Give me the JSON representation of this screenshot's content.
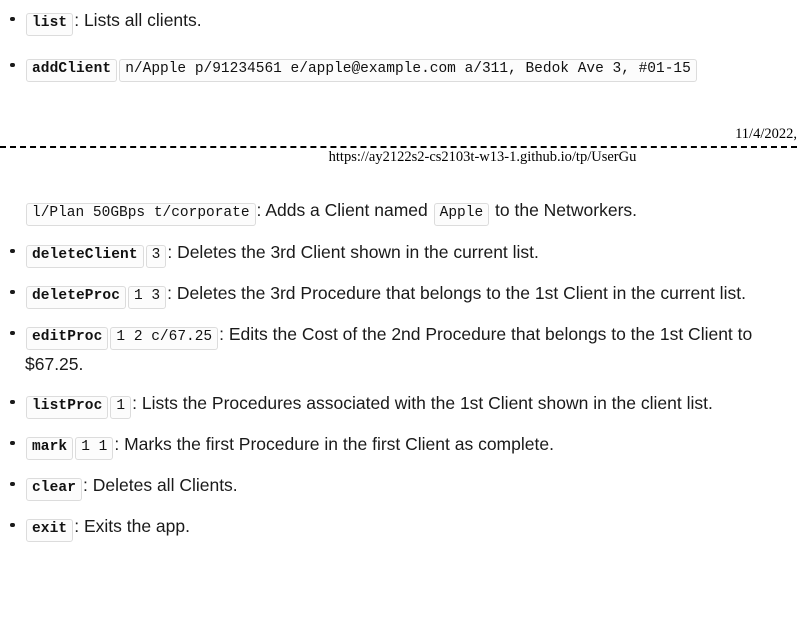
{
  "document": {
    "type": "user-guide-command-summary",
    "page_break": {
      "date": "11/4/2022, ",
      "url": "https://ay2122s2-cs2103t-w13-1.github.io/tp/UserGu"
    }
  },
  "page_one": {
    "items": [
      {
        "command": "list",
        "args": null,
        "separator": ": ",
        "description": "Lists all clients."
      },
      {
        "command": "addClient",
        "args": "n/Apple p/91234561 e/apple@example.com a/311, Bedok Ave 3, #01-15",
        "separator": "",
        "description": ""
      }
    ]
  },
  "page_two": {
    "continuation": {
      "args": "l/Plan 50GBps t/corporate",
      "separator": ": ",
      "text_before": "Adds a Client named ",
      "inline_code": "Apple",
      "text_after": " to the Networkers."
    },
    "items": [
      {
        "command": "deleteClient",
        "args": "3",
        "separator": ": ",
        "description": "Deletes the 3rd Client shown in the current list."
      },
      {
        "command": "deleteProc",
        "args": "1 3",
        "separator": ": ",
        "description": "Deletes the 3rd Procedure that belongs to the 1st Client in the current list."
      },
      {
        "command": "editProc",
        "args": "1 2 c/67.25",
        "separator": ": ",
        "description": "Edits the Cost of the 2nd Procedure that belongs to the 1st Client to $67.25."
      },
      {
        "command": "listProc",
        "args": "1",
        "separator": ": ",
        "description": "Lists the Procedures associated with the 1st Client shown in the client list."
      },
      {
        "command": "mark",
        "args": "1 1",
        "separator": ": ",
        "description": "Marks the first Procedure in the first Client as complete."
      },
      {
        "command": "clear",
        "args": null,
        "separator": ": ",
        "description": "Deletes all Clients."
      },
      {
        "command": "exit",
        "args": null,
        "separator": ": ",
        "description": "Exits the app."
      }
    ]
  },
  "colors": {
    "text": "#1a1a1a",
    "code_border": "#dcdcdc",
    "code_bg": "#fcfcfc",
    "rule": "#000000"
  }
}
